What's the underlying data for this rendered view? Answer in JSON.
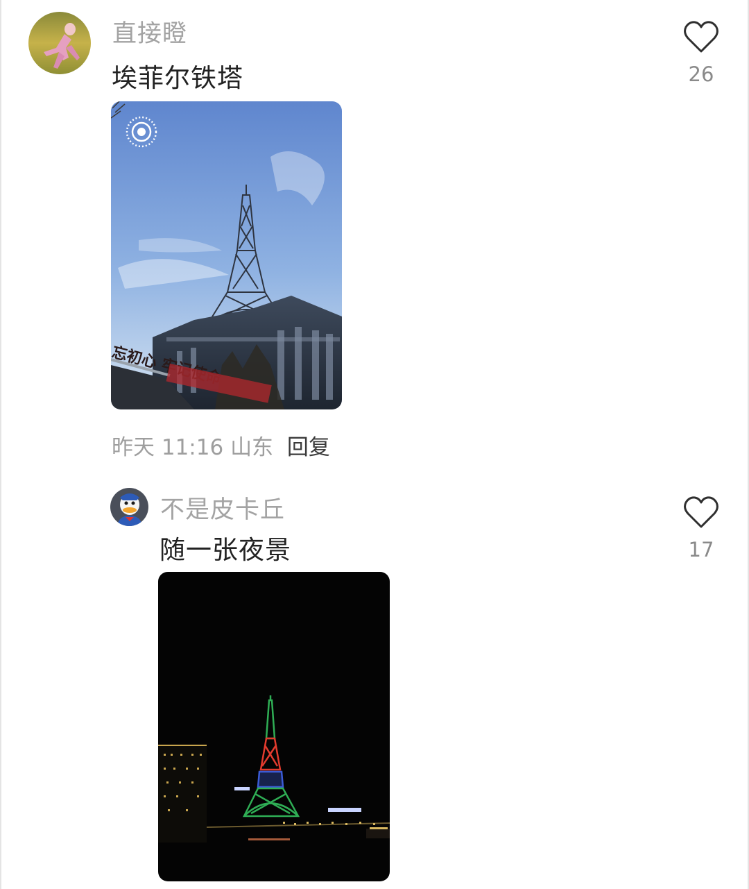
{
  "comments": [
    {
      "username": "直接瞪",
      "content": "埃菲尔铁塔",
      "time": "昨天 11:16",
      "location": "山东",
      "reply_label": "回复",
      "like_count": "26",
      "photo_sign_text": "忘初心 牢记使命",
      "colors": {
        "sky_top": "#5d84cc",
        "sky_bottom": "#cfe0f2",
        "avatar_bg": "#b0a044"
      }
    },
    {
      "username": "不是皮卡丘",
      "content": "随一张夜景",
      "like_count": "17",
      "colors": {
        "night_bg": "#050505",
        "tower_red": "#e23b2e",
        "tower_green": "#2fae55",
        "tower_blue": "#3b5bd6"
      }
    }
  ]
}
